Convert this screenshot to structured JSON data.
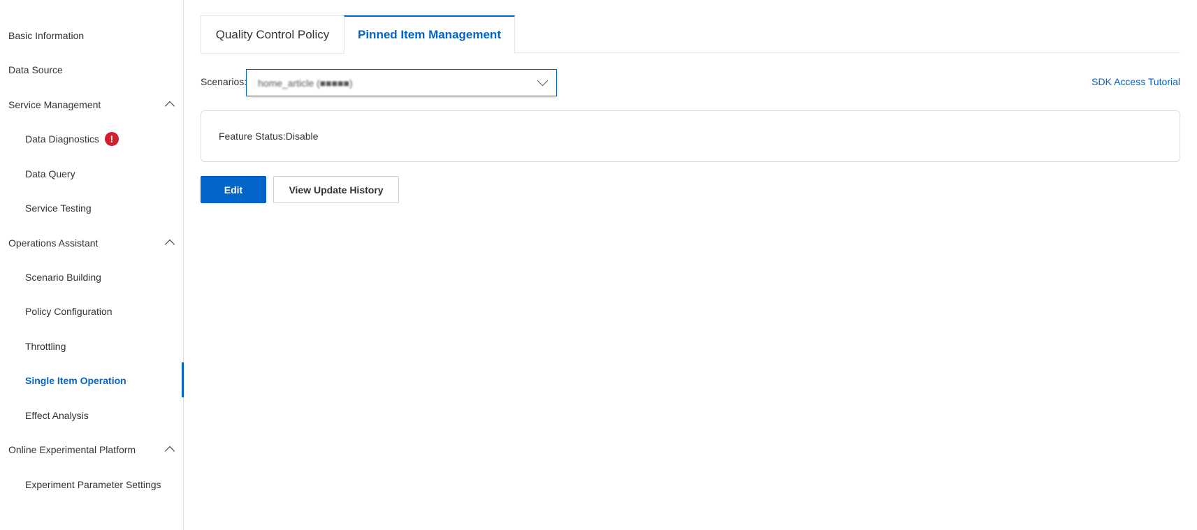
{
  "sidebar": {
    "items": [
      {
        "label": "Basic Information"
      },
      {
        "label": "Data Source"
      },
      {
        "label": "Service Management"
      },
      {
        "label": "Data Diagnostics"
      },
      {
        "label": "Data Query"
      },
      {
        "label": "Service Testing"
      },
      {
        "label": "Operations Assistant"
      },
      {
        "label": "Scenario Building"
      },
      {
        "label": "Policy Configuration"
      },
      {
        "label": "Throttling"
      },
      {
        "label": "Single Item Operation"
      },
      {
        "label": "Effect Analysis"
      },
      {
        "label": "Online Experimental Platform"
      },
      {
        "label": "Experiment Parameter Settings"
      }
    ],
    "warning_badge": "!"
  },
  "tabs": [
    {
      "label": "Quality Control Policy"
    },
    {
      "label": "Pinned Item Management"
    }
  ],
  "scenarios": {
    "label": "Scenarios:",
    "value": "home_article (■■■■■)"
  },
  "sdk_link": "SDK Access Tutorial",
  "feature_status": "Feature Status:Disable",
  "buttons": {
    "edit": "Edit",
    "history": "View Update History"
  },
  "colors": {
    "accent": "#0064c8",
    "warning": "#d0202f"
  }
}
